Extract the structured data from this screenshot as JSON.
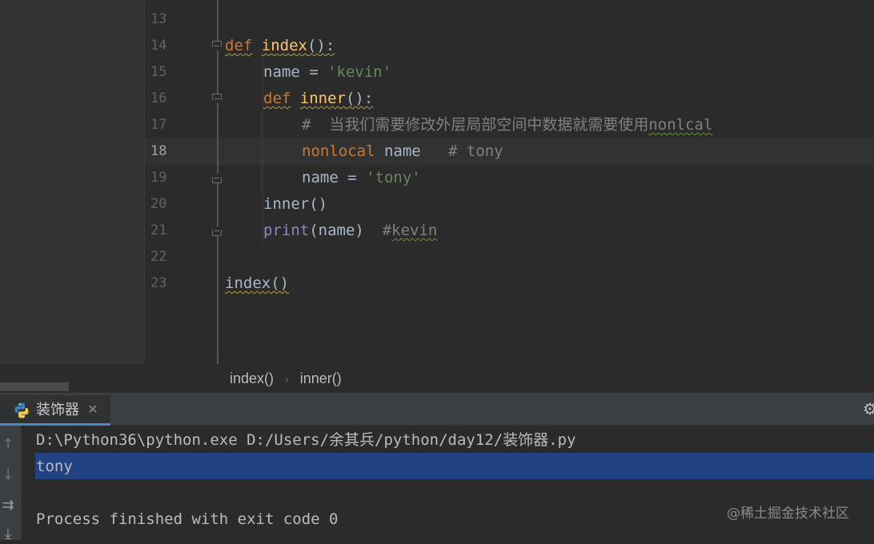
{
  "editor": {
    "line_numbers": [
      "13",
      "14",
      "15",
      "16",
      "17",
      "18",
      "19",
      "20",
      "21",
      "22",
      "23"
    ],
    "active_line": "18",
    "code": {
      "l14": {
        "kw": "def",
        "fn": "index",
        "punct": "():"
      },
      "l15": {
        "name": "name",
        "op": " = ",
        "str": "'kevin'"
      },
      "l16": {
        "kw": "def",
        "fn": "inner",
        "punct": "():"
      },
      "l17": {
        "comment": "#  当我们需要修改外层局部空间中数据就需要使用",
        "comment_tail": "nonlcal"
      },
      "l18": {
        "kw": "nonlocal",
        "name": " name",
        "comment": "   # tony"
      },
      "l19": {
        "name": "name",
        "op": " = ",
        "str": "'tony'"
      },
      "l20": {
        "call": "inner()"
      },
      "l21": {
        "builtin": "print",
        "args": "(name)",
        "comment_hash": "  #",
        "comment_word": "kevin"
      },
      "l23": {
        "call": "index()"
      }
    }
  },
  "breadcrumb": {
    "items": [
      "index()",
      "inner()"
    ],
    "separator": "›"
  },
  "run_panel": {
    "tab_label": "装饰器",
    "console": {
      "command": "D:\\Python36\\python.exe D:/Users/余其兵/python/day12/装饰器.py",
      "output": "tony",
      "status": "Process finished with exit code 0"
    }
  },
  "watermark": "@稀土掘金技术社区",
  "icons": {
    "tab_icon": "python-icon",
    "close": "close-icon",
    "settings": "gear-icon",
    "toolbar": [
      "arrow-up-icon",
      "arrow-down-icon",
      "soft-wrap-icon",
      "scroll-to-end-icon"
    ]
  },
  "colors": {
    "keyword": "#cc7832",
    "function": "#ffc66d",
    "string": "#6a8759",
    "comment": "#808080",
    "builtin": "#8888c6",
    "selection": "#214283",
    "tab_underline": "#4a88c7"
  }
}
